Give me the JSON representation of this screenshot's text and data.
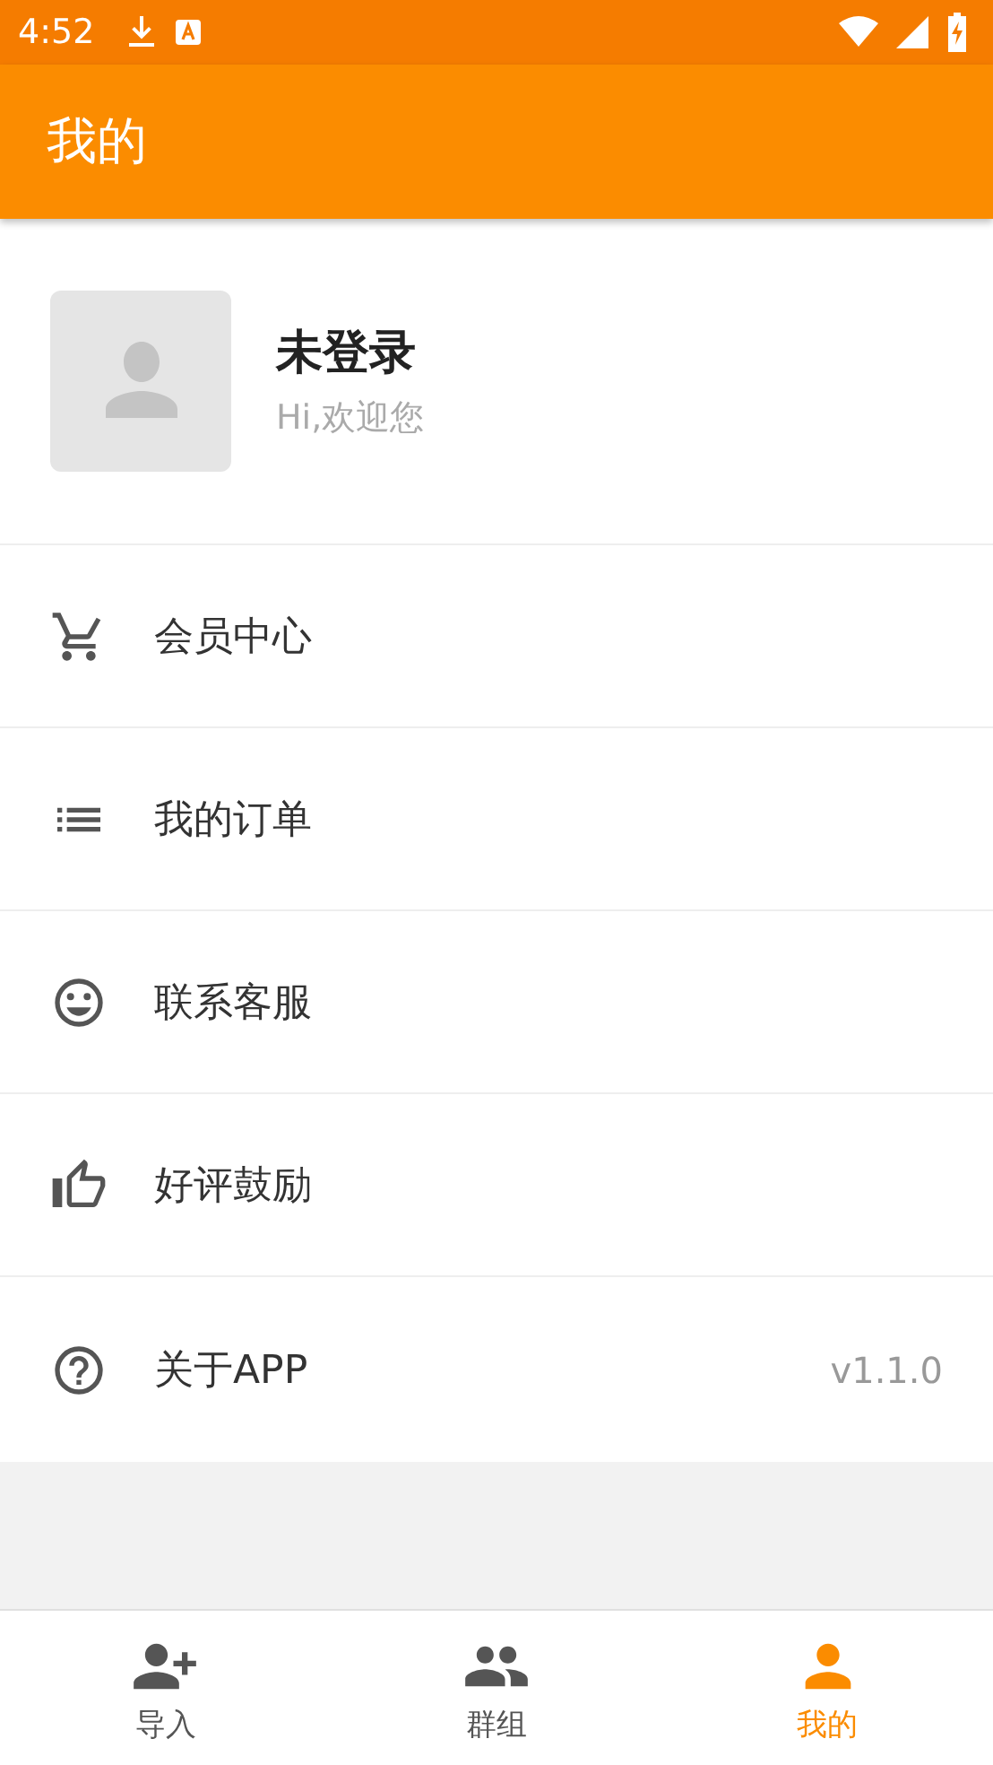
{
  "status_bar": {
    "time": "4:52"
  },
  "app_bar": {
    "title": "我的"
  },
  "profile": {
    "name": "未登录",
    "greeting": "Hi,欢迎您"
  },
  "menu": [
    {
      "kind": "cart",
      "label": "会员中心"
    },
    {
      "kind": "list",
      "label": "我的订单"
    },
    {
      "kind": "smile",
      "label": "联系客服"
    },
    {
      "kind": "thumb",
      "label": "好评鼓励"
    },
    {
      "kind": "help",
      "label": "关于APP",
      "value": "v1.1.0"
    }
  ],
  "bottom_nav": [
    {
      "kind": "person-add",
      "label": "导入",
      "selected": false
    },
    {
      "kind": "people",
      "label": "群组",
      "selected": false
    },
    {
      "kind": "person",
      "label": "我的",
      "selected": true
    }
  ]
}
